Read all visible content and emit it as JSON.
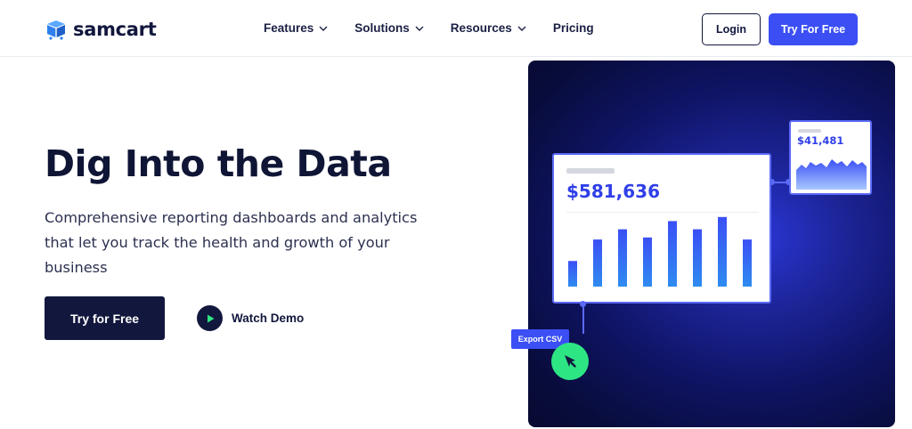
{
  "header": {
    "logo_text": "samcart",
    "nav": [
      {
        "label": "Features",
        "has_dropdown": true
      },
      {
        "label": "Solutions",
        "has_dropdown": true
      },
      {
        "label": "Resources",
        "has_dropdown": true
      },
      {
        "label": "Pricing",
        "has_dropdown": false
      }
    ],
    "login_label": "Login",
    "try_label": "Try For Free"
  },
  "hero": {
    "title": "Dig Into the Data",
    "subtitle": "Comprehensive reporting dashboards and analytics that let you track the health and growth of your business",
    "cta_label": "Try for Free",
    "watch_label": "Watch Demo"
  },
  "illustration": {
    "main_value": "$581,636",
    "small_value": "$41,481",
    "bar_heights": [
      0.25,
      0.46,
      0.56,
      0.48,
      0.64,
      0.56,
      0.68,
      0.46
    ],
    "export_label": "Export CSV"
  },
  "colors": {
    "brand_blue": "#3b4ff5",
    "navy": "#12173d",
    "accent_green": "#2ee584"
  },
  "icons": {
    "logo": "cart-box-icon",
    "dropdown": "chevron-down-icon",
    "play": "play-icon",
    "cursor": "cursor-arrow-icon"
  }
}
